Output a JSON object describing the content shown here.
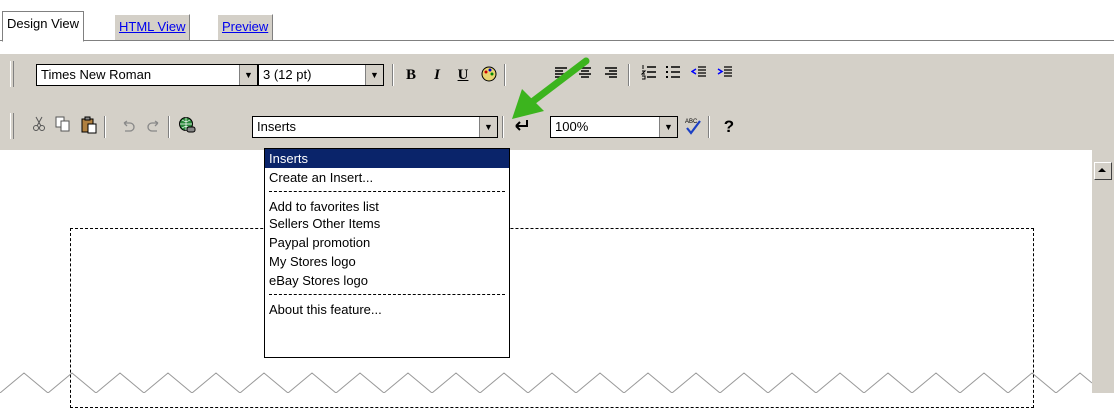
{
  "tabs": [
    {
      "label": "Design View",
      "active": true
    },
    {
      "label": "HTML View",
      "active": false
    },
    {
      "label": "Preview",
      "active": false
    }
  ],
  "toolbar1": {
    "font_family": "Times New Roman",
    "font_size": "3 (12 pt)",
    "bold": "B",
    "italic": "I",
    "underline": "U"
  },
  "toolbar2": {
    "inserts_value": "Inserts",
    "zoom_value": "100%",
    "spell_label": "ABC",
    "help": "?"
  },
  "inserts_menu": {
    "items": [
      "Inserts",
      "Create an Insert...",
      "Add to favorites list",
      "Sellers Other Items",
      "Paypal promotion",
      "My Stores logo",
      "eBay Stores logo",
      "About this feature..."
    ],
    "selected_index": 0
  },
  "colors": {
    "toolbar_bg": "#d4d0c8",
    "selection_bg": "#0a246a",
    "link": "#0000ee",
    "arrow": "#3cb41e"
  }
}
